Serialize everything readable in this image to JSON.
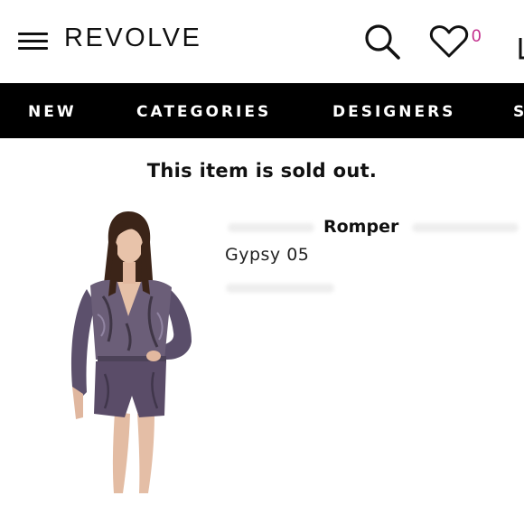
{
  "header": {
    "logo": "REVOLVE",
    "wishlist_count": "0",
    "icons": [
      "menu-icon",
      "search-icon",
      "heart-icon",
      "bag-icon"
    ]
  },
  "nav": {
    "items": [
      {
        "label": "NEW"
      },
      {
        "label": "CATEGORIES"
      },
      {
        "label": "DESIGNERS"
      },
      {
        "label": "S"
      }
    ]
  },
  "main": {
    "status_message": "This item is sold out.",
    "product": {
      "name": "Romper",
      "designer": "Gypsy 05"
    }
  },
  "colors": {
    "nav_background": "#000000",
    "accent": "#c2298a",
    "text": "#111111"
  }
}
